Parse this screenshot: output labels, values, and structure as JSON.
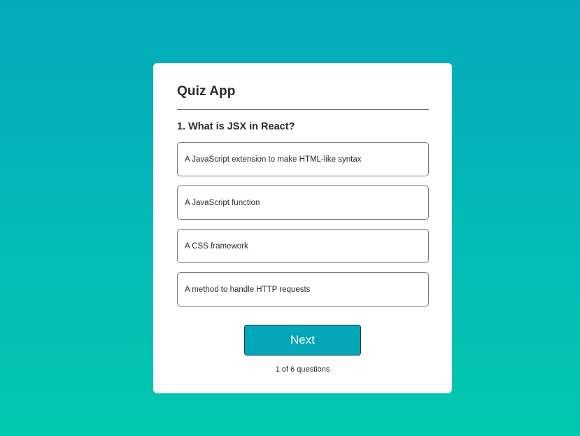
{
  "app": {
    "title": "Quiz App"
  },
  "question": {
    "text": "1. What is JSX in React?"
  },
  "options": [
    {
      "label": "A JavaScript extension to make HTML-like syntax"
    },
    {
      "label": "A JavaScript function"
    },
    {
      "label": "A CSS framework"
    },
    {
      "label": "A method to handle HTTP requests"
    }
  ],
  "controls": {
    "next_label": "Next"
  },
  "progress": {
    "text": "1 of 6 questions"
  },
  "colors": {
    "background_top": "#04aabc",
    "background_bottom": "#02c8b0",
    "button": "#05a6ba"
  }
}
